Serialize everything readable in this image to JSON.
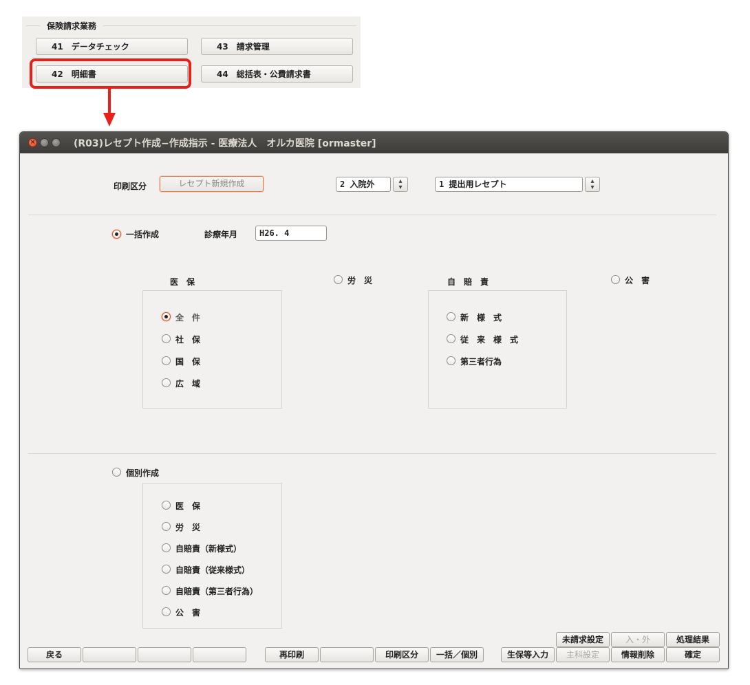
{
  "menu": {
    "title": "保険請求業務",
    "buttons": {
      "data_check": "41　データチェック",
      "invoice": "42　明細書",
      "billing_mgmt": "43　請求管理",
      "summary": "44　総括表・公費請求書"
    },
    "accent_color": "#e8201a"
  },
  "window": {
    "title": "(R03)レセプト作成−作成指示 - 医療法人　オルカ医院 [ormaster]"
  },
  "form": {
    "print_kubun_label": "印刷区分",
    "print_kubun_button": "レセプト新規作成",
    "inout_value": "2 入院外",
    "receipt_type_value": "1 提出用レセプト",
    "bulk_label": "一括作成",
    "shinryo_label": "診療年月",
    "shinryo_value": "H26. 4",
    "iho_label": "医　保",
    "rousai_label": "労　災",
    "jibai_label": "自　賠　責",
    "kougai_label": "公　害",
    "iho_options": [
      "全　件",
      "社　保",
      "国　保",
      "広　域"
    ],
    "jibai_options": [
      "新　様　式",
      "従　来　様　式",
      "第三者行為"
    ],
    "individual_label": "個別作成",
    "individual_options": [
      "医　保",
      "労　災",
      "自賠責（新様式）",
      "自賠責（従来様式）",
      "自賠責（第三者行為）",
      "公　害"
    ]
  },
  "footer": {
    "back": "戻る",
    "reprint": "再印刷",
    "print_kubun": "印刷区分",
    "bulk_individual": "一括／個別",
    "seiho_input": "生保等入力",
    "shuka_setting": "主科設定",
    "info_delete": "情報削除",
    "confirm": "確定",
    "unbilled_setting": "未請求設定",
    "in_out": "入・外",
    "process_result": "処理結果"
  }
}
